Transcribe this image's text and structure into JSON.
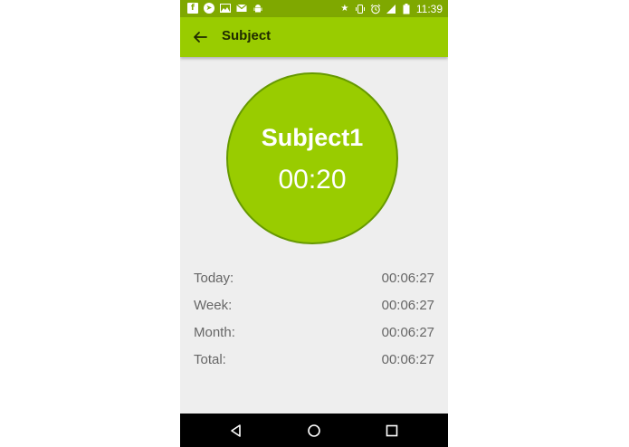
{
  "status_bar": {
    "left_icons": [
      "facebook-icon",
      "telegram-icon",
      "image-icon",
      "gmail-icon",
      "android-icon"
    ],
    "right_icons": [
      "star-icon",
      "vibrate-icon",
      "alarm-icon",
      "signal-icon",
      "battery-icon"
    ],
    "time": "11:39"
  },
  "app_bar": {
    "title": "Subject",
    "background": "#99cc00"
  },
  "timer": {
    "subject": "Subject1",
    "elapsed": "00:20",
    "fill_color": "#99cc00",
    "border_color": "#669900"
  },
  "stats": [
    {
      "label": "Today:",
      "value": "00:06:27"
    },
    {
      "label": "Week:",
      "value": "00:06:27"
    },
    {
      "label": "Month:",
      "value": "00:06:27"
    },
    {
      "label": "Total:",
      "value": "00:06:27"
    }
  ],
  "nav_bar": {
    "buttons": [
      "back-icon",
      "home-icon",
      "recents-icon"
    ]
  }
}
